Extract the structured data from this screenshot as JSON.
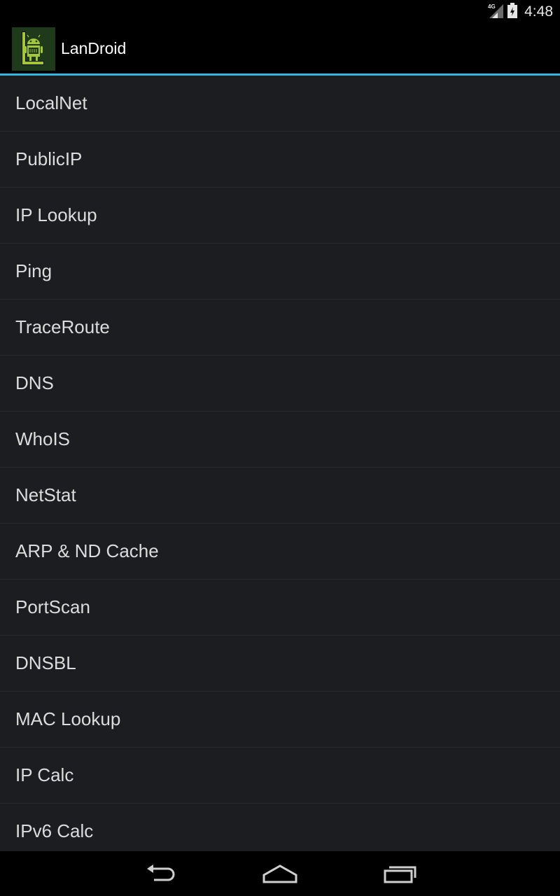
{
  "status_bar": {
    "network_label": "4G",
    "time": "4:48",
    "icons": [
      "signal-icon",
      "battery-icon"
    ]
  },
  "action_bar": {
    "title": "LanDroid",
    "icon": "app-logo-icon",
    "accent_color": "#33b5e5"
  },
  "menu": {
    "items": [
      {
        "label": "LocalNet"
      },
      {
        "label": "PublicIP"
      },
      {
        "label": "IP Lookup"
      },
      {
        "label": "Ping"
      },
      {
        "label": "TraceRoute"
      },
      {
        "label": "DNS"
      },
      {
        "label": "WhoIS"
      },
      {
        "label": "NetStat"
      },
      {
        "label": "ARP & ND Cache"
      },
      {
        "label": "PortScan"
      },
      {
        "label": "DNSBL"
      },
      {
        "label": "MAC Lookup"
      },
      {
        "label": "IP Calc"
      },
      {
        "label": "IPv6 Calc"
      }
    ]
  },
  "nav_bar": {
    "buttons": [
      "back-icon",
      "home-icon",
      "recents-icon"
    ]
  }
}
